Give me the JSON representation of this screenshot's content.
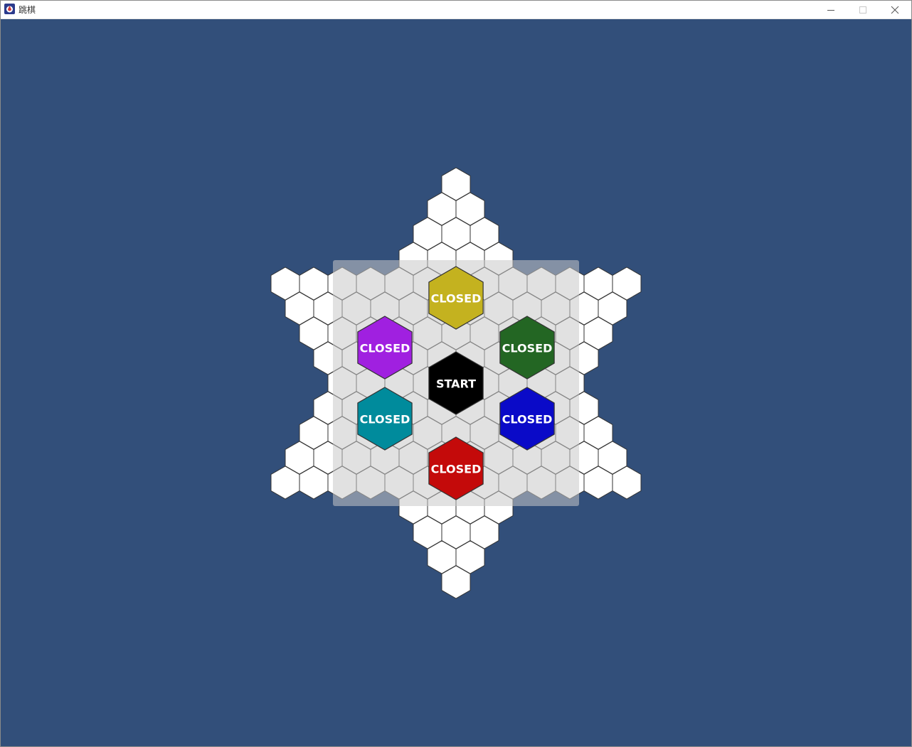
{
  "window": {
    "title": "跳棋",
    "minimize_icon": "minimize-icon",
    "maximize_icon": "maximize-icon",
    "close_icon": "close-icon"
  },
  "colors": {
    "background": "#324f7a",
    "cell_fill": "#ffffff",
    "cell_stroke": "#333333",
    "overlay": "#c8c8c8"
  },
  "menu": {
    "items": [
      {
        "label": "CLOSED",
        "color": "#c4b21f",
        "enabled": false
      },
      {
        "label": "CLOSED",
        "color": "#a020e0",
        "enabled": false
      },
      {
        "label": "CLOSED",
        "color": "#236623",
        "enabled": false
      },
      {
        "label": "START",
        "color": "#000000",
        "enabled": true
      },
      {
        "label": "CLOSED",
        "color": "#008b9c",
        "enabled": false
      },
      {
        "label": "CLOSED",
        "color": "#0a0ac8",
        "enabled": false
      },
      {
        "label": "CLOSED",
        "color": "#c40a0a",
        "enabled": false
      }
    ]
  }
}
